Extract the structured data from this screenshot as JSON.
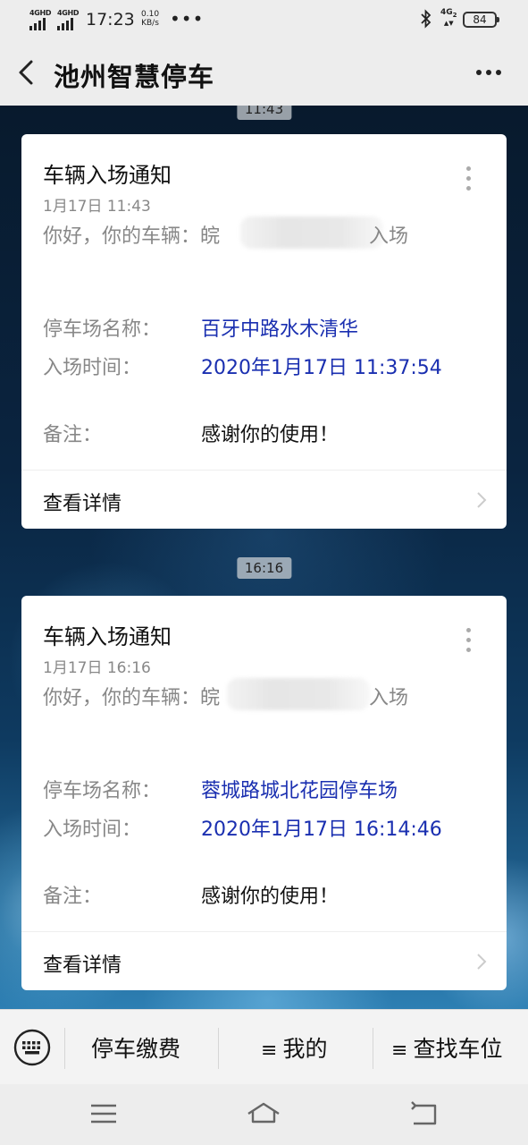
{
  "status_bar": {
    "sim1": "4GHD",
    "sim2": "4GHD",
    "time": "17:23",
    "speed_value": "0.10",
    "speed_unit": "KB/s",
    "dots": "•••",
    "network": "4G",
    "network_sub": "2",
    "battery": "84"
  },
  "header": {
    "title": "池州智慧停车",
    "back_icon": "chevron-left-icon",
    "more_icon": "more-horizontal-icon"
  },
  "messages": [
    {
      "time_pill": "11:43",
      "title": "车辆入场通知",
      "date": "1月17日  11:43",
      "greeting_prefix": "你好，你的车辆：皖",
      "greeting_suffix": "入场",
      "lot_label": "停车场名称：",
      "lot_value": "百牙中路水木清华",
      "time_label": "入场时间：",
      "time_value": "2020年1月17日 11:37:54",
      "note_label": "备注：",
      "note_value": "感谢你的使用！",
      "link": "查看详情"
    },
    {
      "time_pill": "16:16",
      "title": "车辆入场通知",
      "date": "1月17日  16:16",
      "greeting_prefix": "你好，你的车辆：皖",
      "greeting_suffix": "入场",
      "lot_label": "停车场名称：",
      "lot_value": "蓉城路城北花园停车场",
      "time_label": "入场时间：",
      "time_value": "2020年1月17日 16:14:46",
      "note_label": "备注：",
      "note_value": "感谢你的使用！",
      "link": "查看详情"
    }
  ],
  "bottom_menu": {
    "keyboard_icon": "keyboard-icon",
    "item1": "停车缴费",
    "item2_icon": "≡",
    "item2": "我的",
    "item3_icon": "≡",
    "item3": "查找车位"
  },
  "colors": {
    "link_blue": "#1a2fb0",
    "label_gray": "#888888",
    "bg": "#ededed"
  }
}
